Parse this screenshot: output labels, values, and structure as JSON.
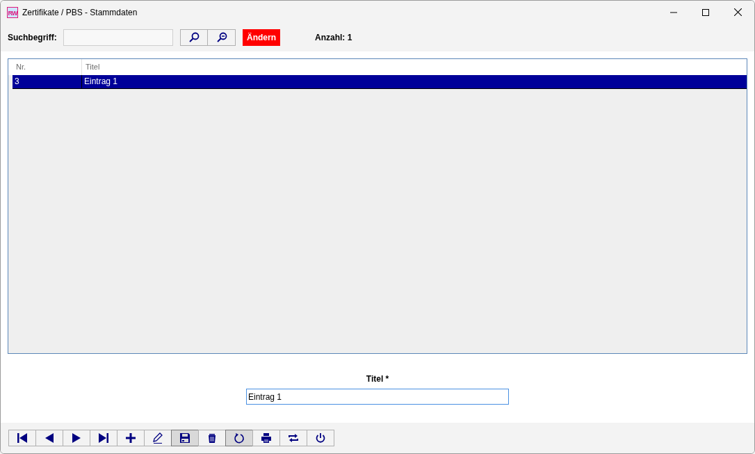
{
  "window": {
    "logo": "RW",
    "title": "Zertifikate / PBS - Stammdaten"
  },
  "search": {
    "label": "Suchbegriff:",
    "change_button": "Ändern",
    "count": "Anzahl: 1"
  },
  "table": {
    "columns": [
      "Nr.",
      "Titel"
    ],
    "rows": [
      {
        "cells": [
          "3",
          "Eintrag 1"
        ],
        "selected": true
      }
    ]
  },
  "form": {
    "label": "Titel *",
    "value": "Eintrag 1"
  },
  "toolbar": [
    {
      "kind": "first",
      "pressed": false
    },
    {
      "kind": "prev",
      "pressed": false
    },
    {
      "kind": "next",
      "pressed": false
    },
    {
      "kind": "last",
      "pressed": false
    },
    {
      "kind": "add",
      "pressed": false
    },
    {
      "kind": "edit",
      "pressed": false
    },
    {
      "kind": "save",
      "pressed": true
    },
    {
      "kind": "delete",
      "pressed": false
    },
    {
      "kind": "refresh",
      "pressed": true
    },
    {
      "kind": "print",
      "pressed": false
    },
    {
      "kind": "swap",
      "pressed": false
    },
    {
      "kind": "power",
      "pressed": false
    }
  ]
}
